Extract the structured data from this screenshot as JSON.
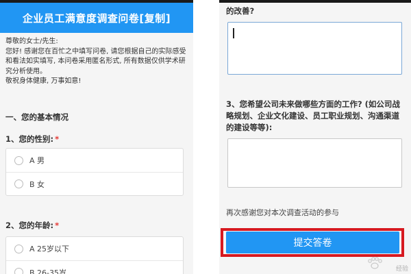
{
  "survey": {
    "title": "企业员工满意度调查问卷[复制]",
    "intro_lines": [
      "尊敬的女士/先生:",
      "您好! 感谢您在百忙之中填写问卷, 请您根据自己的实际感受和看法如实填写, 本问卷采用匿名形式, 所有数据仅供学术研究分析使用。",
      "敬祝身体健康, 万事如意!"
    ],
    "section1_heading": "一、您的基本情况",
    "required_mark": "*",
    "q1": {
      "title": "1、您的性别:",
      "options": [
        "A 男",
        "B 女"
      ]
    },
    "q2": {
      "title": "2、您的年龄:",
      "options": [
        "A 25岁以下",
        "B 26-35岁"
      ]
    }
  },
  "right": {
    "q2_tail": "的改善?",
    "q3_title": "3、您希望公司未来做哪些方面的工作? (如公司战略规划、企业文化建设、员工职业规划、沟通渠道的建设等等):",
    "thanks": "再次感谢您对本次调查活动的参与",
    "submit_label": "提交答卷"
  },
  "watermark": "经验",
  "colors": {
    "primary": "#2196f3",
    "highlight": "#d71920",
    "required": "#e53935"
  }
}
